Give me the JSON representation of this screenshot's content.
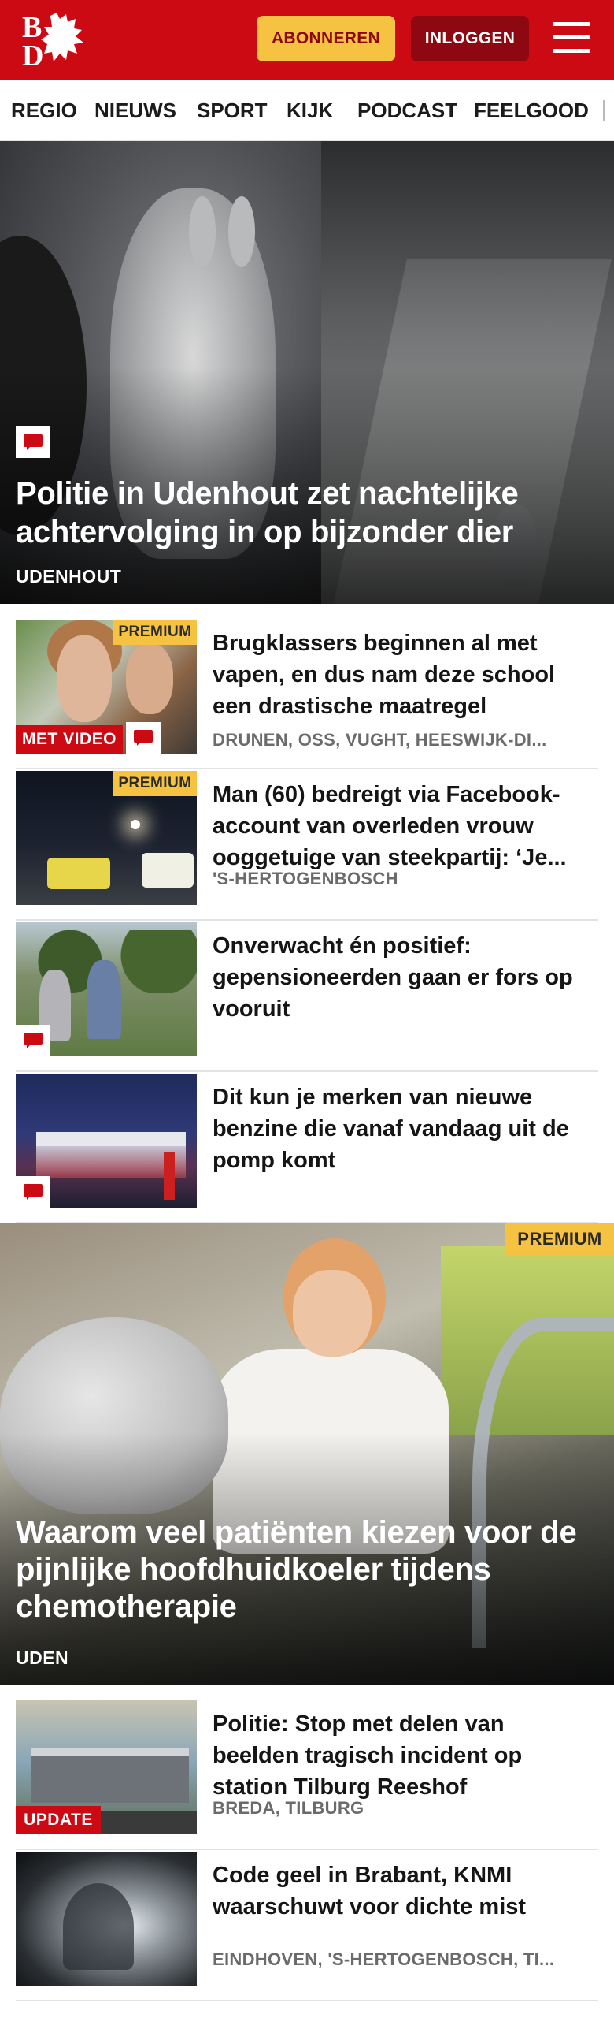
{
  "header": {
    "logo_letters": [
      "B",
      "D"
    ],
    "subscribe_label": "ABONNEREN",
    "login_label": "INLOGGEN",
    "brand_color": "#cc0a14",
    "accent_color": "#f5c242"
  },
  "nav": {
    "items": [
      "REGIO",
      "NIEUWS",
      "SPORT",
      "KIJK",
      "PODCAST",
      "FEELGOOD"
    ]
  },
  "featured": {
    "title_lines": [
      "Politie in Udenhout zet nachtelijke",
      "achtervolging in op bijzonder dier"
    ],
    "location": "UDENHOUT",
    "has_comments": true
  },
  "articles": [
    {
      "title_lines": [
        "Brugklassers beginnen al met",
        "vapen, en dus nam deze school",
        "een drastische maatregel"
      ],
      "location": "DRUNEN, OSS, VUGHT, HEESWIJK-DI...",
      "premium_label": "PREMIUM",
      "video_label": "MET VIDEO",
      "has_comments": true
    },
    {
      "title_lines": [
        "Man (60) bedreigt via Facebook-",
        "account van overleden vrouw",
        "ooggetuige van steekpartij: ‘Je..."
      ],
      "location": "'S-HERTOGENBOSCH",
      "premium_label": "PREMIUM"
    },
    {
      "title_lines": [
        "Onverwacht én positief:",
        "gepensioneerden gaan er fors op",
        "vooruit"
      ],
      "has_comments": true
    },
    {
      "title_lines": [
        "Dit kun je merken van nieuwe",
        "benzine die vanaf vandaag uit de",
        "pomp komt"
      ],
      "has_comments": true
    }
  ],
  "featured2": {
    "premium_label": "PREMIUM",
    "title_lines": [
      "Waarom veel patiënten kiezen voor de",
      "pijnlijke hoofdhuidkoeler tijdens",
      "chemotherapie"
    ],
    "location": "UDEN"
  },
  "articles2": [
    {
      "title_lines": [
        "Politie: Stop met delen van",
        "beelden tragisch incident op",
        "station Tilburg Reeshof"
      ],
      "location": "BREDA, TILBURG",
      "update_label": "UPDATE"
    },
    {
      "title_lines": [
        "Code geel in Brabant, KNMI",
        "waarschuwt voor dichte mist"
      ],
      "location": "EINDHOVEN, 'S-HERTOGENBOSCH, TI..."
    }
  ]
}
